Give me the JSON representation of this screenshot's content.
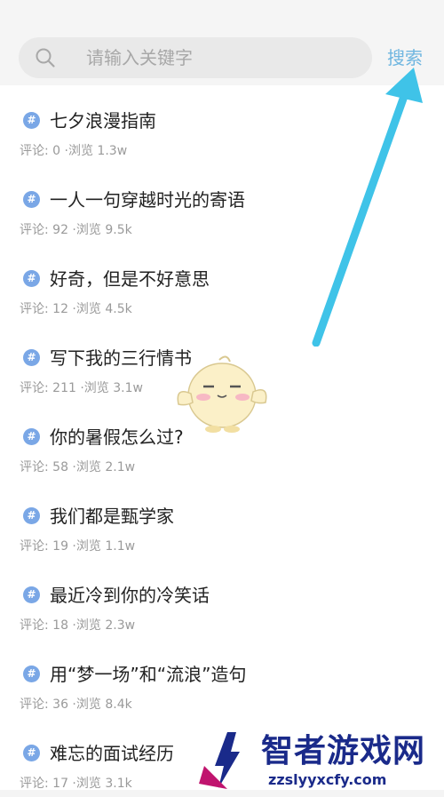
{
  "search": {
    "placeholder": "请输入关键字",
    "button_label": "搜索"
  },
  "topics": [
    {
      "title": "七夕浪漫指南",
      "meta": "评论: 0 ·浏览 1.3w"
    },
    {
      "title": "一人一句穿越时光的寄语",
      "meta": "评论: 92 ·浏览 9.5k"
    },
    {
      "title": "好奇，但是不好意思",
      "meta": "评论: 12 ·浏览 4.5k"
    },
    {
      "title": "写下我的三行情书",
      "meta": "评论: 211 ·浏览 3.1w"
    },
    {
      "title": "你的暑假怎么过?",
      "meta": "评论: 58 ·浏览 2.1w"
    },
    {
      "title": "我们都是甄学家",
      "meta": "评论: 19 ·浏览 1.1w"
    },
    {
      "title": "最近冷到你的冷笑话",
      "meta": "评论: 18 ·浏览 2.3w"
    },
    {
      "title": "用“梦一场”和“流浪”造句",
      "meta": "评论: 36 ·浏览 8.4k"
    },
    {
      "title": "难忘的面试经历",
      "meta": "评论: 17 ·浏览 3.1k"
    }
  ],
  "topic_icon": "#",
  "watermark": {
    "brand": "智者游戏网",
    "domain": "zzslyyxcfy.com"
  },
  "colors": {
    "accent": "#6fb6e0",
    "arrow": "#3fc3e8",
    "hash_badge": "#7aa7e6"
  },
  "icons": [
    "search-icon",
    "hash-icon",
    "annotation-arrow",
    "mascot-sticker",
    "site-logo"
  ]
}
